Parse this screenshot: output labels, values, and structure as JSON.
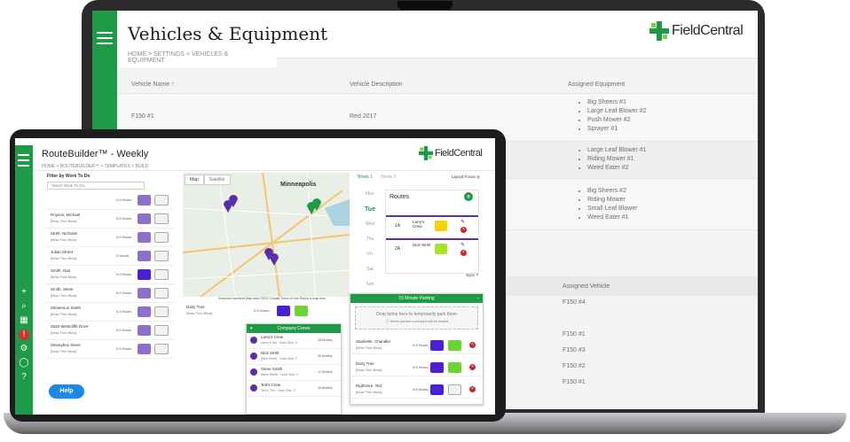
{
  "laptop": {
    "title": "Vehicles & Equipment",
    "logo_text": "FieldCentral",
    "breadcrumb": "HOME > SETTINGS > VEHICLES & EQUIPMENT",
    "columns": {
      "name": "Vehicle Name",
      "description": "Vehicle Description",
      "equipment": "Assigned Equipment"
    },
    "rows": [
      {
        "name": "F150 #1",
        "description": "Red 2017",
        "equipment": [
          "Big Sheers #1",
          "Large Leaf Blower #2",
          "Push Mower #2",
          "Sprayer #1"
        ]
      },
      {
        "name": "",
        "description": "",
        "equipment": [
          "Large Leaf Blower #1",
          "Riding Mower #1",
          "Weed Eater #2"
        ]
      },
      {
        "name": "",
        "description": "",
        "equipment": [
          "Big Sheers #2",
          "Riding Mower",
          "Small Leaf Blower",
          "Weed Eater #1"
        ]
      }
    ],
    "assigned_vehicle_header": "Assigned Vehicle",
    "assigned_vehicles": [
      "F150 #4",
      "F150 #1",
      "F150 #3",
      "F150 #2",
      "F150 #1"
    ]
  },
  "tablet": {
    "title": "RouteBuilder™ - Weekly",
    "logo_text": "FieldCentral",
    "breadcrumb": "HOME > ROUTEBUILDER™ > TEMPLATES > BUILD",
    "filter_label": "Filter by Work To Do",
    "filter_placeholder": "Select Work To Do...",
    "work_items": [
      {
        "name": "",
        "sub": "",
        "hours": "0.5 Hours",
        "color": "#8e6fc9"
      },
      {
        "name": "Royson, Michael",
        "sub": "[Mow Trim Blow]",
        "hours": "0.5 Hours",
        "color": "#8e6fc9"
      },
      {
        "name": "Strelt, Nicholas",
        "sub": "[Mow Trim Blow]",
        "hours": "0.5 Hours",
        "color": "#8e6fc9"
      },
      {
        "name": "Julian Street",
        "sub": "[Mow Trim Blow]",
        "hours": "3 Hours",
        "color": "#8e6fc9"
      },
      {
        "name": "Smith, Dan",
        "sub": "[Mow Trim Blow]",
        "hours": "0.5 Hours",
        "color": "#4b1fd6"
      },
      {
        "name": "Smith, Steve",
        "sub": "[Mow Trim Blow]",
        "hours": "0.5 Hours",
        "color": "#8e6fc9"
      },
      {
        "name": "Stevenson Smith",
        "sub": "[Mow Trim Blow]",
        "hours": "0.5 Hours",
        "color": "#8e6fc9"
      },
      {
        "name": "2525 Westcliffe Drive",
        "sub": "[Mow Trim Blow]",
        "hours": "0.5 Hours",
        "color": "#8e6fc9"
      },
      {
        "name": "Steveyboy Steve",
        "sub": "[Mow Trim Blow]",
        "hours": "0.5 Hours",
        "color": "#8e6fc9"
      }
    ],
    "map": {
      "tab_map": "Map",
      "tab_satellite": "Satellite",
      "city": "Minneapolis",
      "footer": "Keyboard shortcuts   Map data ©2022 Google   Terms of Use   Report a map error"
    },
    "dairy": {
      "name": "Dairy Tree",
      "sub": "[Mow Trim Blow]",
      "hours": "0.5 Hours"
    },
    "routes": {
      "week1": "Week 1",
      "week2": "Week 2",
      "layout_focus": "Layout Focus",
      "heading": "Routes",
      "days": [
        "Mon",
        "Tue",
        "Wed",
        "Thu",
        "Fri",
        "Sat",
        "Sun"
      ],
      "active_day": "Tue",
      "items": [
        {
          "id": "1A",
          "crew": "Larry's Crew",
          "tag_color": "#f5d400"
        },
        {
          "id": "2A",
          "crew": "Nick Strelt",
          "tag_color": "#a6e32b"
        }
      ],
      "sync": "Sync"
    },
    "parking": {
      "title": "15 Minute Parking",
      "drop_text": "Drop items here to temporarily park them",
      "note": "Items parked overnight will be towed",
      "items": [
        {
          "name": "Stankelle, Chandler",
          "sub": "[Mow Trim Blow]",
          "hours": "0.5 Hours",
          "c1": "#4b1fd6",
          "c2": "#6dd435"
        },
        {
          "name": "Dairy Tree",
          "sub": "[Mow Trim Blow]",
          "hours": "0.5 Hours",
          "c1": "#4b1fd6",
          "c2": "#6dd435"
        },
        {
          "name": "Rightmire, Ted",
          "sub": "[Mow Trim Blow]",
          "hours": "0.8 Hours",
          "c1": "#4b1fd6",
          "c2": "#f2f2f2"
        }
      ]
    },
    "crews": {
      "title": "Company Crews",
      "items": [
        {
          "name": "Larry's Crew",
          "sub": "Larry & Jim · Crew Size: 3",
          "months": "18 Months"
        },
        {
          "name": "Nick Strelt",
          "sub": "[Nick Strelt] · Crew Size: 1",
          "months": "20 Months"
        },
        {
          "name": "Steve Smith",
          "sub": "Steve Smith · Crew Size: 2",
          "months": "12 Months"
        },
        {
          "name": "Ted's Crew",
          "sub": "Ted & Tim · Crew Size: 2",
          "months": "16 Months"
        }
      ]
    },
    "help": "Help"
  },
  "colors": {
    "brand_green": "#1f9a48",
    "route_purple": "#5b2fa8",
    "help_blue": "#1e88e5"
  }
}
